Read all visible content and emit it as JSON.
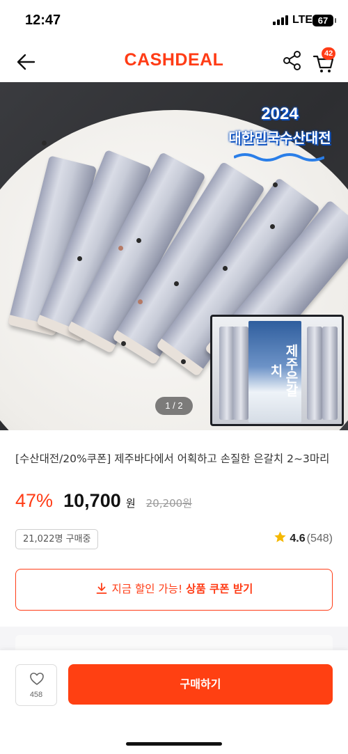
{
  "status_bar": {
    "time": "12:47",
    "network": "LTE",
    "battery": "67"
  },
  "header": {
    "logo": "CASHDEAL",
    "cart_count": "42",
    "icons": [
      "back-arrow-icon",
      "share-icon",
      "cart-icon"
    ]
  },
  "product_image": {
    "event_year": "2024",
    "event_name": "대한민국수산대전",
    "package_title": "제주은갈치",
    "page_indicator": "1 / 2"
  },
  "product": {
    "title": "[수산대전/20%쿠폰] 제주바다에서 어획하고 손질한 은갈치 2~3마리",
    "discount": "47%",
    "price": "10,700",
    "currency": "원",
    "original_price": "20,200원",
    "buyers": "21,022명 구매중",
    "rating": "4.6",
    "review_count": "(548)"
  },
  "coupon": {
    "text_pre": "지금 할인 가능! ",
    "text_strong": "상품 쿠폰 받기",
    "icon": "download-icon"
  },
  "bottom_bar": {
    "like_count": "458",
    "buy_label": "구매하기"
  },
  "colors": {
    "accent": "#ff3c16",
    "star": "#f5b800"
  }
}
